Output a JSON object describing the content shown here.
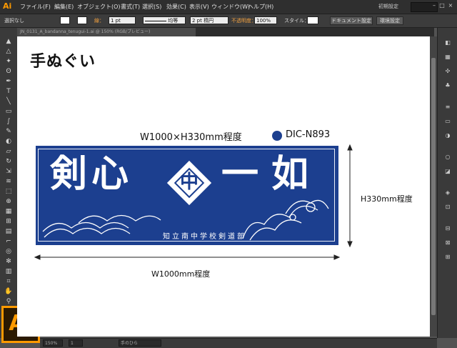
{
  "app": {
    "logo": "Ai",
    "workspace": "初期設定"
  },
  "menu": [
    "ファイル(F)",
    "編集(E)",
    "オブジェクト(O)",
    "書式(T)",
    "選択(S)",
    "効果(C)",
    "表示(V)",
    "ウィンドウ(W)",
    "ヘルプ(H)"
  ],
  "control": {
    "selection": "選択なし",
    "stroke_label": "線：",
    "stroke_weight": "1 pt",
    "profile": "均等",
    "brush": "2 pt 楕円",
    "opacity_label": "不透明度：",
    "opacity": "100%",
    "style_label": "スタイル：",
    "doc_settings": "ドキュメント設定",
    "prefs": "環境設定"
  },
  "document": {
    "tab": "JN_0131_A_bandanna_tenugui-1.ai @ 150% (RGB/プレビュー)"
  },
  "status": {
    "zoom": "150%",
    "page": "1",
    "tool": "手のひら"
  },
  "artwork": {
    "title": "手ぬぐい",
    "size_note": "W1000×H330mm程度",
    "color_name": "DIC-N893",
    "color": "#1c3f8f",
    "banner_left": "剣心",
    "banner_right": "一如",
    "emblem_char": "中",
    "school": "知立南中学校剣道部",
    "height_label": "H330mm程度",
    "width_label": "W1000mm程度"
  },
  "icons": [
    "selection-icon",
    "direct-selection-icon",
    "magic-wand-icon",
    "lasso-icon",
    "pen-icon",
    "type-icon",
    "line-icon",
    "rectangle-icon",
    "paintbrush-icon",
    "pencil-icon",
    "blob-brush-icon",
    "eraser-icon",
    "rotate-icon",
    "scale-icon",
    "width-icon",
    "free-transform-icon",
    "shape-builder-icon",
    "perspective-icon",
    "mesh-icon",
    "gradient-icon",
    "eyedropper-icon",
    "blend-icon",
    "symbol-sprayer-icon",
    "graph-icon",
    "artboard-icon",
    "slice-icon",
    "hand-icon",
    "zoom-icon"
  ]
}
